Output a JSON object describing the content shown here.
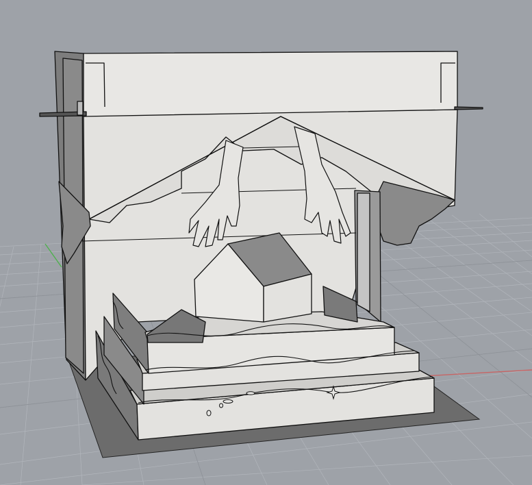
{
  "viewport": {
    "view_name": "",
    "display_mode": "shaded",
    "background_color": "#9ea2a8",
    "grid_color": "#b0b4ba",
    "grid_major_color": "#8b8f95",
    "x_axis_color": "#c86464",
    "y_axis_color": "#4fb04f"
  },
  "model": {
    "face_light": "#e7e6e3",
    "face_mid": "#cfcecb",
    "face_dark": "#7b7b7b",
    "face_shadow": "#a9a9a9",
    "edge_color": "#111111",
    "ground_shadow": "#6c6c6c",
    "objects": [
      "box-frame",
      "roof-eaves",
      "hanging-hands",
      "house",
      "stepped-base",
      "wave-layers",
      "left-side-panel"
    ]
  }
}
